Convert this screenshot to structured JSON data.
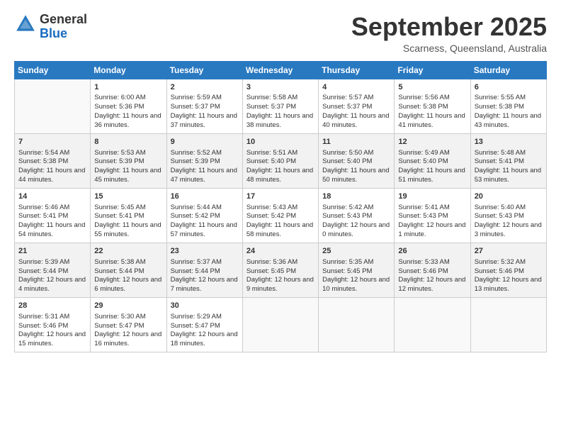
{
  "header": {
    "logo_general": "General",
    "logo_blue": "Blue",
    "month_title": "September 2025",
    "location": "Scarness, Queensland, Australia"
  },
  "weekdays": [
    "Sunday",
    "Monday",
    "Tuesday",
    "Wednesday",
    "Thursday",
    "Friday",
    "Saturday"
  ],
  "weeks": [
    [
      {
        "day": "",
        "sunrise": "",
        "sunset": "",
        "daylight": ""
      },
      {
        "day": "1",
        "sunrise": "Sunrise: 6:00 AM",
        "sunset": "Sunset: 5:36 PM",
        "daylight": "Daylight: 11 hours and 36 minutes."
      },
      {
        "day": "2",
        "sunrise": "Sunrise: 5:59 AM",
        "sunset": "Sunset: 5:37 PM",
        "daylight": "Daylight: 11 hours and 37 minutes."
      },
      {
        "day": "3",
        "sunrise": "Sunrise: 5:58 AM",
        "sunset": "Sunset: 5:37 PM",
        "daylight": "Daylight: 11 hours and 38 minutes."
      },
      {
        "day": "4",
        "sunrise": "Sunrise: 5:57 AM",
        "sunset": "Sunset: 5:37 PM",
        "daylight": "Daylight: 11 hours and 40 minutes."
      },
      {
        "day": "5",
        "sunrise": "Sunrise: 5:56 AM",
        "sunset": "Sunset: 5:38 PM",
        "daylight": "Daylight: 11 hours and 41 minutes."
      },
      {
        "day": "6",
        "sunrise": "Sunrise: 5:55 AM",
        "sunset": "Sunset: 5:38 PM",
        "daylight": "Daylight: 11 hours and 43 minutes."
      }
    ],
    [
      {
        "day": "7",
        "sunrise": "Sunrise: 5:54 AM",
        "sunset": "Sunset: 5:38 PM",
        "daylight": "Daylight: 11 hours and 44 minutes."
      },
      {
        "day": "8",
        "sunrise": "Sunrise: 5:53 AM",
        "sunset": "Sunset: 5:39 PM",
        "daylight": "Daylight: 11 hours and 45 minutes."
      },
      {
        "day": "9",
        "sunrise": "Sunrise: 5:52 AM",
        "sunset": "Sunset: 5:39 PM",
        "daylight": "Daylight: 11 hours and 47 minutes."
      },
      {
        "day": "10",
        "sunrise": "Sunrise: 5:51 AM",
        "sunset": "Sunset: 5:40 PM",
        "daylight": "Daylight: 11 hours and 48 minutes."
      },
      {
        "day": "11",
        "sunrise": "Sunrise: 5:50 AM",
        "sunset": "Sunset: 5:40 PM",
        "daylight": "Daylight: 11 hours and 50 minutes."
      },
      {
        "day": "12",
        "sunrise": "Sunrise: 5:49 AM",
        "sunset": "Sunset: 5:40 PM",
        "daylight": "Daylight: 11 hours and 51 minutes."
      },
      {
        "day": "13",
        "sunrise": "Sunrise: 5:48 AM",
        "sunset": "Sunset: 5:41 PM",
        "daylight": "Daylight: 11 hours and 53 minutes."
      }
    ],
    [
      {
        "day": "14",
        "sunrise": "Sunrise: 5:46 AM",
        "sunset": "Sunset: 5:41 PM",
        "daylight": "Daylight: 11 hours and 54 minutes."
      },
      {
        "day": "15",
        "sunrise": "Sunrise: 5:45 AM",
        "sunset": "Sunset: 5:41 PM",
        "daylight": "Daylight: 11 hours and 55 minutes."
      },
      {
        "day": "16",
        "sunrise": "Sunrise: 5:44 AM",
        "sunset": "Sunset: 5:42 PM",
        "daylight": "Daylight: 11 hours and 57 minutes."
      },
      {
        "day": "17",
        "sunrise": "Sunrise: 5:43 AM",
        "sunset": "Sunset: 5:42 PM",
        "daylight": "Daylight: 11 hours and 58 minutes."
      },
      {
        "day": "18",
        "sunrise": "Sunrise: 5:42 AM",
        "sunset": "Sunset: 5:43 PM",
        "daylight": "Daylight: 12 hours and 0 minutes."
      },
      {
        "day": "19",
        "sunrise": "Sunrise: 5:41 AM",
        "sunset": "Sunset: 5:43 PM",
        "daylight": "Daylight: 12 hours and 1 minute."
      },
      {
        "day": "20",
        "sunrise": "Sunrise: 5:40 AM",
        "sunset": "Sunset: 5:43 PM",
        "daylight": "Daylight: 12 hours and 3 minutes."
      }
    ],
    [
      {
        "day": "21",
        "sunrise": "Sunrise: 5:39 AM",
        "sunset": "Sunset: 5:44 PM",
        "daylight": "Daylight: 12 hours and 4 minutes."
      },
      {
        "day": "22",
        "sunrise": "Sunrise: 5:38 AM",
        "sunset": "Sunset: 5:44 PM",
        "daylight": "Daylight: 12 hours and 6 minutes."
      },
      {
        "day": "23",
        "sunrise": "Sunrise: 5:37 AM",
        "sunset": "Sunset: 5:44 PM",
        "daylight": "Daylight: 12 hours and 7 minutes."
      },
      {
        "day": "24",
        "sunrise": "Sunrise: 5:36 AM",
        "sunset": "Sunset: 5:45 PM",
        "daylight": "Daylight: 12 hours and 9 minutes."
      },
      {
        "day": "25",
        "sunrise": "Sunrise: 5:35 AM",
        "sunset": "Sunset: 5:45 PM",
        "daylight": "Daylight: 12 hours and 10 minutes."
      },
      {
        "day": "26",
        "sunrise": "Sunrise: 5:33 AM",
        "sunset": "Sunset: 5:46 PM",
        "daylight": "Daylight: 12 hours and 12 minutes."
      },
      {
        "day": "27",
        "sunrise": "Sunrise: 5:32 AM",
        "sunset": "Sunset: 5:46 PM",
        "daylight": "Daylight: 12 hours and 13 minutes."
      }
    ],
    [
      {
        "day": "28",
        "sunrise": "Sunrise: 5:31 AM",
        "sunset": "Sunset: 5:46 PM",
        "daylight": "Daylight: 12 hours and 15 minutes."
      },
      {
        "day": "29",
        "sunrise": "Sunrise: 5:30 AM",
        "sunset": "Sunset: 5:47 PM",
        "daylight": "Daylight: 12 hours and 16 minutes."
      },
      {
        "day": "30",
        "sunrise": "Sunrise: 5:29 AM",
        "sunset": "Sunset: 5:47 PM",
        "daylight": "Daylight: 12 hours and 18 minutes."
      },
      {
        "day": "",
        "sunrise": "",
        "sunset": "",
        "daylight": ""
      },
      {
        "day": "",
        "sunrise": "",
        "sunset": "",
        "daylight": ""
      },
      {
        "day": "",
        "sunrise": "",
        "sunset": "",
        "daylight": ""
      },
      {
        "day": "",
        "sunrise": "",
        "sunset": "",
        "daylight": ""
      }
    ]
  ]
}
